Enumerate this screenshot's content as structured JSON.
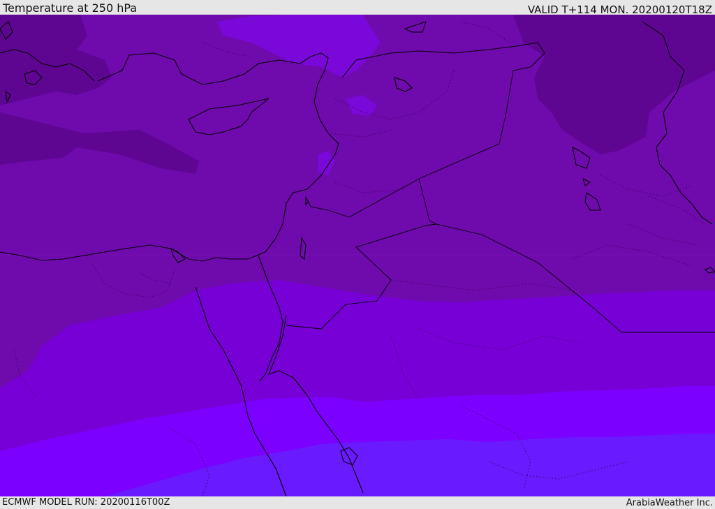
{
  "header": {
    "title": "Temperature at 250 hPa",
    "valid": "VALID T+114 MON. 20200120T18Z"
  },
  "footer": {
    "model_run": "ECMWF MODEL RUN: 20200116T00Z",
    "credit": "ArabiaWeather Inc."
  },
  "colors": {
    "band_darkest": "#5e0592",
    "band_dark": "#6f0aad",
    "band_mid": "#7700d6",
    "band_violet": "#7b00ff",
    "band_blue_violet": "#6a1aff",
    "coastline": "#000000",
    "border_dotted": "#3b0060"
  }
}
